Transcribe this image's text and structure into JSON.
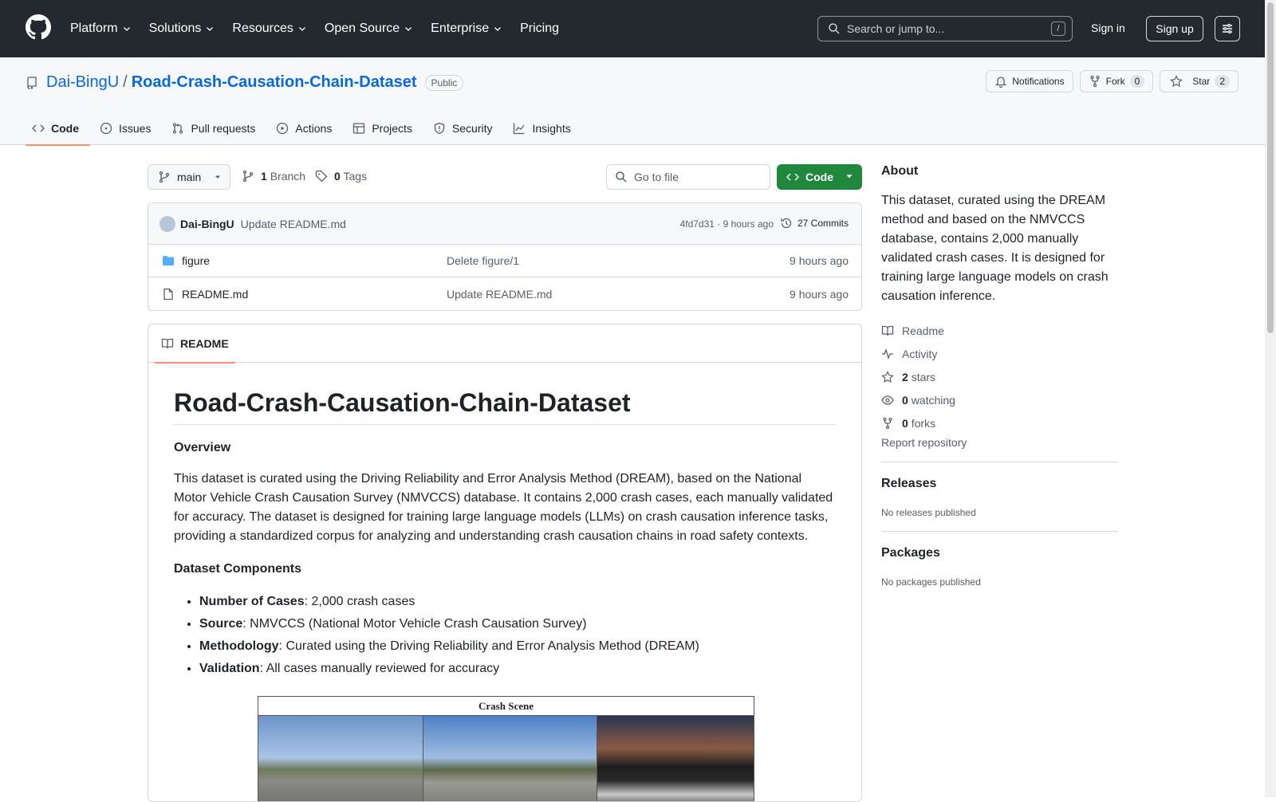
{
  "header": {
    "nav": [
      {
        "label": "Platform",
        "has_menu": true
      },
      {
        "label": "Solutions",
        "has_menu": true
      },
      {
        "label": "Resources",
        "has_menu": true
      },
      {
        "label": "Open Source",
        "has_menu": true
      },
      {
        "label": "Enterprise",
        "has_menu": true
      },
      {
        "label": "Pricing",
        "has_menu": false
      }
    ],
    "search_placeholder": "Search or jump to...",
    "search_shortcut": "/",
    "signin": "Sign in",
    "signup": "Sign up"
  },
  "repo": {
    "owner": "Dai-BingU",
    "separator": "/",
    "name": "Road-Crash-Causation-Chain-Dataset",
    "visibility": "Public",
    "notifications": "Notifications",
    "fork_label": "Fork",
    "fork_count": "0",
    "star_label": "Star",
    "star_count": "2"
  },
  "tabs": [
    {
      "label": "Code",
      "icon": "code-icon",
      "active": true
    },
    {
      "label": "Issues",
      "icon": "issue-icon",
      "active": false
    },
    {
      "label": "Pull requests",
      "icon": "pull-request-icon",
      "active": false
    },
    {
      "label": "Actions",
      "icon": "play-icon",
      "active": false
    },
    {
      "label": "Projects",
      "icon": "table-icon",
      "active": false
    },
    {
      "label": "Security",
      "icon": "shield-icon",
      "active": false
    },
    {
      "label": "Insights",
      "icon": "graph-icon",
      "active": false
    }
  ],
  "toolbar": {
    "branch": "main",
    "branch_count": "1",
    "branch_label": "Branch",
    "tag_count": "0",
    "tag_label": "Tags",
    "goto_placeholder": "Go to file",
    "code_label": "Code"
  },
  "commit": {
    "author": "Dai-BingU",
    "message": "Update README.md",
    "meta": "4fd7d31 · 9 hours ago",
    "commits": "27 Commits"
  },
  "files": [
    {
      "type": "folder",
      "name": "figure",
      "message": "Delete figure/1",
      "time": "9 hours ago"
    },
    {
      "type": "file",
      "name": "README.md",
      "message": "Update README.md",
      "time": "9 hours ago"
    }
  ],
  "readme": {
    "tab": "README",
    "title": "Road-Crash-Causation-Chain-Dataset",
    "overview_heading": "Overview",
    "overview": "This dataset is curated using the Driving Reliability and Error Analysis Method (DREAM), based on the National Motor Vehicle Crash Causation Survey (NMVCCS) database. It contains 2,000 crash cases, each manually validated for accuracy. The dataset is designed for training large language models (LLMs) on crash causation inference tasks, providing a standardized corpus for analyzing and understanding crash causation chains in road safety contexts.",
    "components_heading": "Dataset Components",
    "components": [
      {
        "key": "Number of Cases",
        "value": ": 2,000 crash cases"
      },
      {
        "key": "Source",
        "value": ": NMVCCS (National Motor Vehicle Crash Causation Survey)"
      },
      {
        "key": "Methodology",
        "value": ": Curated using the Driving Reliability and Error Analysis Method (DREAM)"
      },
      {
        "key": "Validation",
        "value": ": All cases manually reviewed for accuracy"
      }
    ],
    "figure_title": "Crash Scene"
  },
  "sidebar": {
    "about_heading": "About",
    "about": "This dataset, curated using the DREAM method and based on the NMVCCS database, contains 2,000 manually validated crash cases. It is designed for training large language models on crash causation inference.",
    "readme": "Readme",
    "activity": "Activity",
    "stars_count": "2",
    "stars_label": "stars",
    "watching_count": "0",
    "watching_label": "watching",
    "forks_count": "0",
    "forks_label": "forks",
    "report": "Report repository",
    "releases_heading": "Releases",
    "releases_text": "No releases published",
    "packages_heading": "Packages",
    "packages_text": "No packages published"
  },
  "colors": {
    "header_bg": "#24292f",
    "link": "#0969da",
    "accent_tab": "#fd8c73",
    "code_button": "#1f883d"
  }
}
